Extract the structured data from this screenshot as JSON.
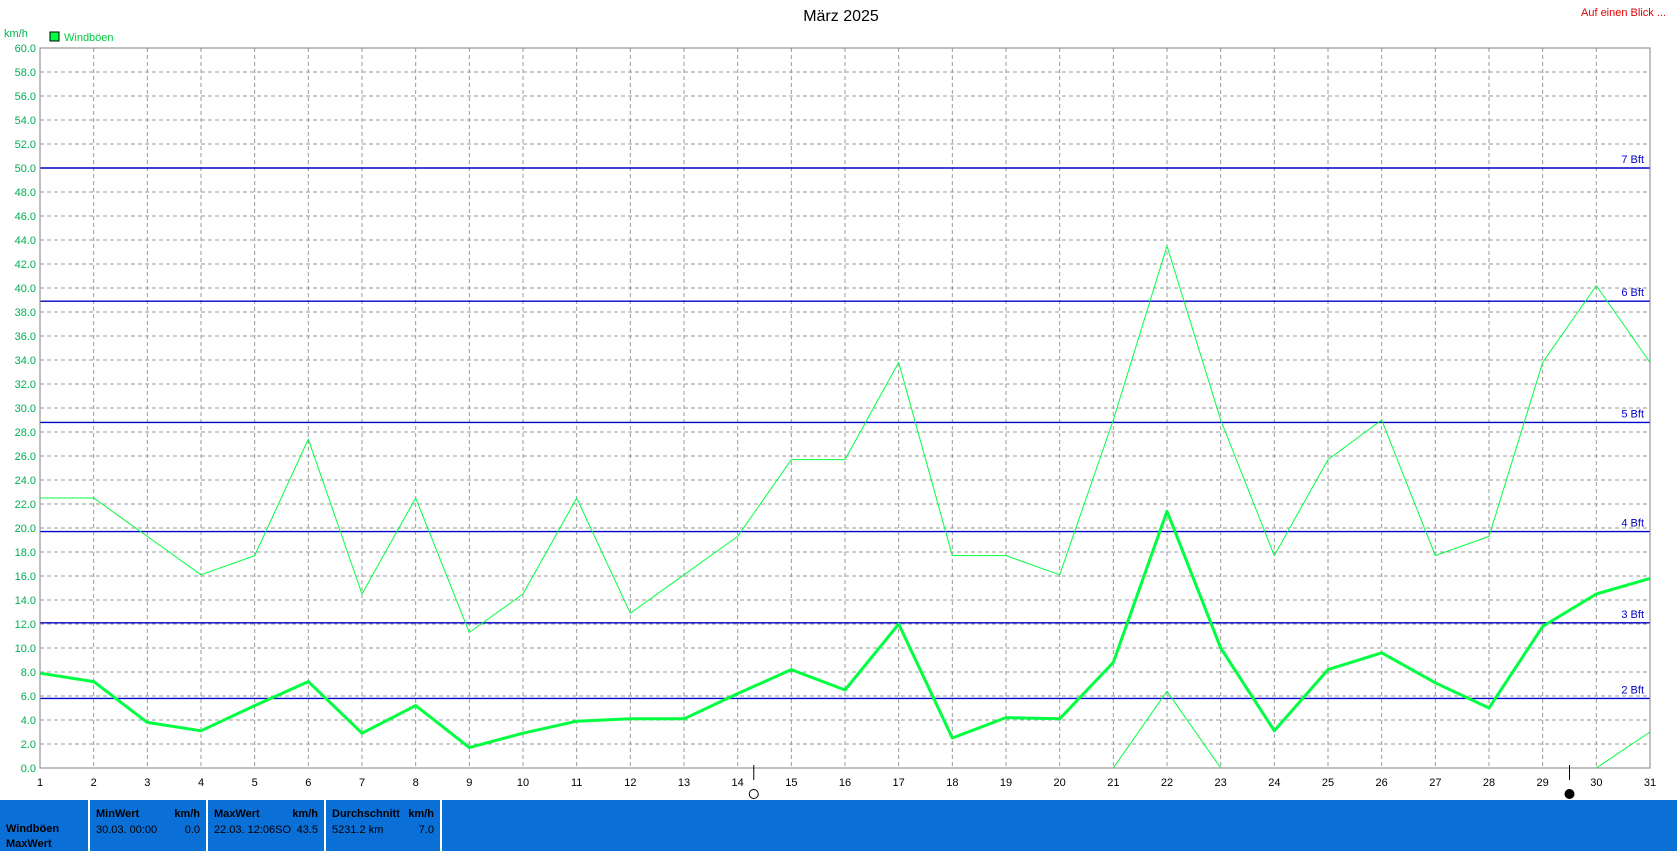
{
  "header": {
    "link_label": "Auf einen Blick ..."
  },
  "chart_data": {
    "type": "line",
    "title": "März 2025",
    "ylabel": "km/h",
    "xlabel": "",
    "ylim": [
      0,
      60
    ],
    "ytick_step": 2,
    "x": [
      1,
      2,
      3,
      4,
      5,
      6,
      7,
      8,
      9,
      10,
      11,
      12,
      13,
      14,
      15,
      16,
      17,
      18,
      19,
      20,
      21,
      22,
      23,
      24,
      25,
      26,
      27,
      28,
      29,
      30,
      31
    ],
    "legend": [
      {
        "label": "Windböen",
        "color": "#00ff40",
        "position": "top-left"
      }
    ],
    "grid": true,
    "series": [
      {
        "name": "Windböen",
        "color": "#00ff40",
        "width": 1,
        "values": [
          22.5,
          22.5,
          19.3,
          16.1,
          17.7,
          27.4,
          14.5,
          22.5,
          11.3,
          14.5,
          22.5,
          12.9,
          16.1,
          19.3,
          25.7,
          25.7,
          33.8,
          17.7,
          17.7,
          16.1,
          29.0,
          43.5,
          29.0,
          17.7,
          25.7,
          29.0,
          17.7,
          19.3,
          33.8,
          40.2,
          33.8
        ]
      },
      {
        "color": "#00ff40",
        "width": 3,
        "values": [
          7.9,
          7.2,
          3.8,
          3.1,
          5.2,
          7.2,
          2.9,
          5.2,
          1.7,
          2.9,
          3.9,
          4.1,
          4.1,
          6.2,
          8.2,
          6.5,
          12.0,
          2.5,
          4.2,
          4.1,
          8.8,
          21.4,
          10.0,
          3.1,
          8.2,
          9.6,
          7.1,
          5.0,
          11.8,
          14.5,
          15.8
        ]
      },
      {
        "color": "#00ff40",
        "width": 1,
        "values": [
          null,
          null,
          null,
          null,
          null,
          null,
          null,
          null,
          null,
          null,
          null,
          null,
          null,
          null,
          null,
          null,
          null,
          null,
          null,
          null,
          0,
          6.4,
          0,
          null,
          null,
          null,
          null,
          null,
          null,
          0,
          3.0
        ]
      }
    ],
    "reference_lines": [
      {
        "label": "2 Bft",
        "value": 5.8,
        "color": "#0000cc"
      },
      {
        "label": "3 Bft",
        "value": 12.1,
        "color": "#0000cc"
      },
      {
        "label": "4 Bft",
        "value": 19.7,
        "color": "#0000cc"
      },
      {
        "label": "5 Bft",
        "value": 28.8,
        "color": "#0000cc"
      },
      {
        "label": "6 Bft",
        "value": 38.9,
        "color": "#0000cc"
      },
      {
        "label": "7 Bft",
        "value": 50.0,
        "color": "#0000cc"
      }
    ],
    "moon_markers": [
      {
        "x": 14.3,
        "phase": "full",
        "icon": "full-moon-icon"
      },
      {
        "x": 29.5,
        "phase": "new",
        "icon": "new-moon-icon"
      }
    ]
  },
  "stats": {
    "row_labels": [
      "Windböen",
      "MaxWert"
    ],
    "min": {
      "title": "MinWert",
      "unit": "km/h",
      "date": "30.03.  00:00",
      "value": "0.0"
    },
    "max": {
      "title": "MaxWert",
      "unit": "km/h",
      "date": "22.03.  12:06SO",
      "value": "43.5"
    },
    "avg": {
      "title": "Durchschnitt",
      "unit": "km/h",
      "date": "5231.2 km",
      "value": "7.0"
    }
  }
}
